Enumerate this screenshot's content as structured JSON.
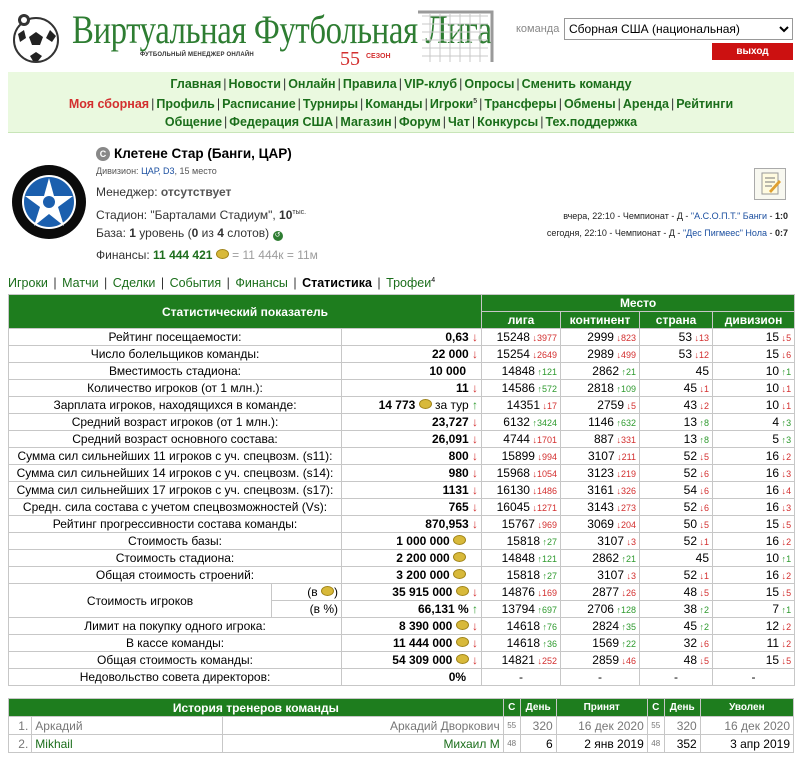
{
  "header": {
    "title": "Виртуальная Футбольная Лига",
    "subtitle": "ФУТБОЛЬНЫЙ МЕНЕДЖЕР ОНЛАЙН",
    "season_num": "55",
    "season_label": "СЕЗОН",
    "team_label": "команда",
    "team_select_value": "Сборная США (национальная)",
    "exit_label": "выход"
  },
  "nav": {
    "row1": [
      "Главная",
      "Новости",
      "Онлайн",
      "Правила",
      "VIP-клуб",
      "Опросы",
      "Сменить команду"
    ],
    "row2": [
      "Моя сборная",
      "Профиль",
      "Расписание",
      "Турниры",
      "Команды",
      "Игроки",
      "Трансферы",
      "Обмены",
      "Аренда",
      "Рейтинги"
    ],
    "row2_sup": "5",
    "row3": [
      "Общение",
      "Федерация США",
      "Магазин",
      "Форум",
      "Чат",
      "Конкурсы",
      "Тех.поддержка"
    ]
  },
  "team": {
    "badge": "С",
    "name": "Клетене Стар (Банги, ЦАР)",
    "division_prefix": "Дивизион: ",
    "division_link": "ЦАР, D3",
    "division_suffix": ", 15 место",
    "manager_label": "Менеджер: ",
    "manager_value": "отсутствует",
    "stadium_label": "Стадион: ",
    "stadium_name": "\"Барталами Стадиум\"",
    "stadium_sep": ", ",
    "stadium_cap": "10",
    "stadium_cap_unit": "тыс.",
    "base_label": "База: ",
    "base_level": "1",
    "base_level_text": " уровень (",
    "base_used": "0",
    "base_of": " из ",
    "base_total": "4",
    "base_slots": " слотов)",
    "finances_label": "Финансы: ",
    "finances_value": "11 444 421",
    "finances_extra": "= 11 444к = 11м"
  },
  "matches": [
    {
      "when": "вчера, 22:10 - Чемпионат - Д - ",
      "opponent": "\"А.С.О.П.Т.\" Банги",
      "sep": " - ",
      "score": "1:0"
    },
    {
      "when": "сегодня, 22:10 - Чемпионат - Д - ",
      "opponent": "\"Дес Пигмеес\" Нола",
      "sep": " - ",
      "score": "0:7"
    }
  ],
  "subnav": {
    "items": [
      "Игроки",
      "Матчи",
      "Сделки",
      "События",
      "Финансы",
      "Статистика",
      "Трофеи"
    ],
    "trophies_sup": "4"
  },
  "stats": {
    "head_indicator": "Статистический показатель",
    "head_place": "Место",
    "head_cols": [
      "лига",
      "континент",
      "страна",
      "дивизион"
    ],
    "rows": [
      {
        "label": "Рейтинг посещаемости:",
        "value": "0,63",
        "arrow": "d",
        "lg": "15248",
        "lgc": "3977",
        "lgd": "d",
        "ct": "2999",
        "ctc": "823",
        "ctd": "d",
        "cn": "53",
        "cnc": "13",
        "cnd": "d",
        "dv": "15",
        "dvc": "5",
        "dvd": "d"
      },
      {
        "label": "Число болельщиков команды:",
        "value": "22 000",
        "arrow": "d",
        "lg": "15254",
        "lgc": "2649",
        "lgd": "d",
        "ct": "2989",
        "ctc": "499",
        "ctd": "d",
        "cn": "53",
        "cnc": "12",
        "cnd": "d",
        "dv": "15",
        "dvc": "6",
        "dvd": "d"
      },
      {
        "label": "Вместимость стадиона:",
        "value": "10 000",
        "arrow": "",
        "lg": "14848",
        "lgc": "121",
        "lgd": "u",
        "ct": "2862",
        "ctc": "21",
        "ctd": "u",
        "cn": "45",
        "cnc": "",
        "cnd": "",
        "dv": "10",
        "dvc": "1",
        "dvd": "u"
      },
      {
        "label": "Количество игроков (от 1 млн.):",
        "value": "11",
        "arrow": "d",
        "lg": "14586",
        "lgc": "572",
        "lgd": "u",
        "ct": "2818",
        "ctc": "109",
        "ctd": "u",
        "cn": "45",
        "cnc": "1",
        "cnd": "d",
        "dv": "10",
        "dvc": "1",
        "dvd": "d"
      },
      {
        "label": "Зарплата игроков, находящихся в команде:",
        "value": "14 773",
        "coin": true,
        "extra": "за тур",
        "arrow": "u",
        "lg": "14351",
        "lgc": "17",
        "lgd": "d",
        "ct": "2759",
        "ctc": "5",
        "ctd": "d",
        "cn": "43",
        "cnc": "2",
        "cnd": "d",
        "dv": "10",
        "dvc": "1",
        "dvd": "d"
      },
      {
        "label": "Средний возраст игроков (от 1 млн.):",
        "value": "23,727",
        "arrow": "d",
        "lg": "6132",
        "lgc": "3424",
        "lgd": "u",
        "ct": "1146",
        "ctc": "632",
        "ctd": "u",
        "cn": "13",
        "cnc": "8",
        "cnd": "u",
        "dv": "4",
        "dvc": "3",
        "dvd": "u"
      },
      {
        "label": "Средний возраст основного состава:",
        "value": "26,091",
        "arrow": "d",
        "lg": "4744",
        "lgc": "1701",
        "lgd": "d",
        "ct": "887",
        "ctc": "331",
        "ctd": "d",
        "cn": "13",
        "cnc": "8",
        "cnd": "u",
        "dv": "5",
        "dvc": "3",
        "dvd": "u"
      },
      {
        "label": "Сумма сил сильнейших 11 игроков с уч. спецвозм. (s11):",
        "value": "800",
        "arrow": "d",
        "lg": "15899",
        "lgc": "994",
        "lgd": "d",
        "ct": "3107",
        "ctc": "211",
        "ctd": "d",
        "cn": "52",
        "cnc": "5",
        "cnd": "d",
        "dv": "16",
        "dvc": "2",
        "dvd": "d"
      },
      {
        "label": "Сумма сил сильнейших 14 игроков с уч. спецвозм. (s14):",
        "value": "980",
        "arrow": "d",
        "lg": "15968",
        "lgc": "1054",
        "lgd": "d",
        "ct": "3123",
        "ctc": "219",
        "ctd": "d",
        "cn": "52",
        "cnc": "6",
        "cnd": "d",
        "dv": "16",
        "dvc": "3",
        "dvd": "d"
      },
      {
        "label": "Сумма сил сильнейших 17 игроков с уч. спецвозм. (s17):",
        "value": "1131",
        "arrow": "d",
        "lg": "16130",
        "lgc": "1486",
        "lgd": "d",
        "ct": "3161",
        "ctc": "326",
        "ctd": "d",
        "cn": "54",
        "cnc": "6",
        "cnd": "d",
        "dv": "16",
        "dvc": "4",
        "dvd": "d"
      },
      {
        "label": "Средн. сила состава с учетом спецвозможностей (Vs):",
        "value": "765",
        "arrow": "d",
        "lg": "16045",
        "lgc": "1271",
        "lgd": "d",
        "ct": "3143",
        "ctc": "273",
        "ctd": "d",
        "cn": "52",
        "cnc": "6",
        "cnd": "d",
        "dv": "16",
        "dvc": "3",
        "dvd": "d"
      },
      {
        "label": "Рейтинг прогрессивности состава команды:",
        "value": "870,953",
        "arrow": "d",
        "lg": "15767",
        "lgc": "969",
        "lgd": "d",
        "ct": "3069",
        "ctc": "204",
        "ctd": "d",
        "cn": "50",
        "cnc": "5",
        "cnd": "d",
        "dv": "15",
        "dvc": "5",
        "dvd": "d"
      },
      {
        "label": "Стоимость базы:",
        "value": "1 000 000",
        "coin": true,
        "arrow": "",
        "lg": "15818",
        "lgc": "27",
        "lgd": "u",
        "ct": "3107",
        "ctc": "3",
        "ctd": "d",
        "cn": "52",
        "cnc": "1",
        "cnd": "d",
        "dv": "16",
        "dvc": "2",
        "dvd": "d"
      },
      {
        "label": "Стоимость стадиона:",
        "value": "2 200 000",
        "coin": true,
        "arrow": "",
        "lg": "14848",
        "lgc": "121",
        "lgd": "u",
        "ct": "2862",
        "ctc": "21",
        "ctd": "u",
        "cn": "45",
        "cnc": "",
        "cnd": "",
        "dv": "10",
        "dvc": "1",
        "dvd": "u"
      },
      {
        "label": "Общая стоимость строений:",
        "value": "3 200 000",
        "coin": true,
        "arrow": "",
        "lg": "15818",
        "lgc": "27",
        "lgd": "u",
        "ct": "3107",
        "ctc": "3",
        "ctd": "d",
        "cn": "52",
        "cnc": "1",
        "cnd": "d",
        "dv": "16",
        "dvc": "2",
        "dvd": "d"
      },
      {
        "label": "Стоимость игроков",
        "sub": "(в ",
        "sub_coin": true,
        "sub_end": ")",
        "value": "35 915 000",
        "coin": true,
        "arrow": "d",
        "lg": "14876",
        "lgc": "169",
        "lgd": "d",
        "ct": "2877",
        "ctc": "26",
        "ctd": "d",
        "cn": "48",
        "cnc": "5",
        "cnd": "d",
        "dv": "15",
        "dvc": "5",
        "dvd": "d",
        "span": 2
      },
      {
        "sub": "(в %)",
        "value": "66,131 %",
        "arrow": "u",
        "lg": "13794",
        "lgc": "697",
        "lgd": "u",
        "ct": "2706",
        "ctc": "128",
        "ctd": "u",
        "cn": "38",
        "cnc": "2",
        "cnd": "u",
        "dv": "7",
        "dvc": "1",
        "dvd": "u",
        "cont": true
      },
      {
        "label": "Лимит на покупку одного игрока:",
        "value": "8 390 000",
        "coin": true,
        "arrow": "d",
        "lg": "14618",
        "lgc": "76",
        "lgd": "u",
        "ct": "2824",
        "ctc": "35",
        "ctd": "u",
        "cn": "45",
        "cnc": "2",
        "cnd": "u",
        "dv": "12",
        "dvc": "2",
        "dvd": "d"
      },
      {
        "label": "В кассе команды:",
        "value": "11 444 000",
        "coin": true,
        "arrow": "d",
        "lg": "14618",
        "lgc": "36",
        "lgd": "u",
        "ct": "1569",
        "ctc": "22",
        "ctd": "u",
        "cn": "32",
        "cnc": "6",
        "cnd": "d",
        "dv": "11",
        "dvc": "2",
        "dvd": "d"
      },
      {
        "label": "Общая стоимость команды:",
        "value": "54 309 000",
        "coin": true,
        "arrow": "d",
        "lg": "14821",
        "lgc": "252",
        "lgd": "d",
        "ct": "2859",
        "ctc": "46",
        "ctd": "d",
        "cn": "48",
        "cnc": "5",
        "cnd": "d",
        "dv": "15",
        "dvc": "5",
        "dvd": "d"
      },
      {
        "label": "Недовольство совета директоров:",
        "value": "0%",
        "arrow": "",
        "lg": "-",
        "lgc": "",
        "lgd": "x",
        "ct": "-",
        "ctc": "",
        "ctd": "x",
        "cn": "-",
        "cnc": "",
        "cnd": "x",
        "dv": "-",
        "dvc": "",
        "dvd": "x",
        "dash": true
      }
    ]
  },
  "history": {
    "title": "История тренеров команды",
    "h_c": "С",
    "h_day": "День",
    "h_hired": "Принят",
    "h_fired": "Уволен",
    "rows": [
      {
        "n": "1.",
        "login": "Аркадий",
        "name": "Аркадий Дворкович",
        "c1": "55",
        "d1": "320",
        "hired": "16 дек 2020",
        "c2": "55",
        "d2": "320",
        "fired": "16 дек 2020",
        "gray": true
      },
      {
        "n": "2.",
        "login": "Mikhail",
        "name": "Михаил М",
        "c1": "48",
        "d1": "6",
        "hired": "2 янв 2019",
        "c2": "48",
        "d2": "352",
        "fired": "3 апр 2019",
        "gray": false
      }
    ]
  },
  "colors": {
    "brand_green": "#2e7d32",
    "header_green": "#1e7d1e",
    "nav_bg": "#eaf9df",
    "exit_red": "#cc1111",
    "up": "#2e9a2e",
    "down": "#d32f2f"
  }
}
